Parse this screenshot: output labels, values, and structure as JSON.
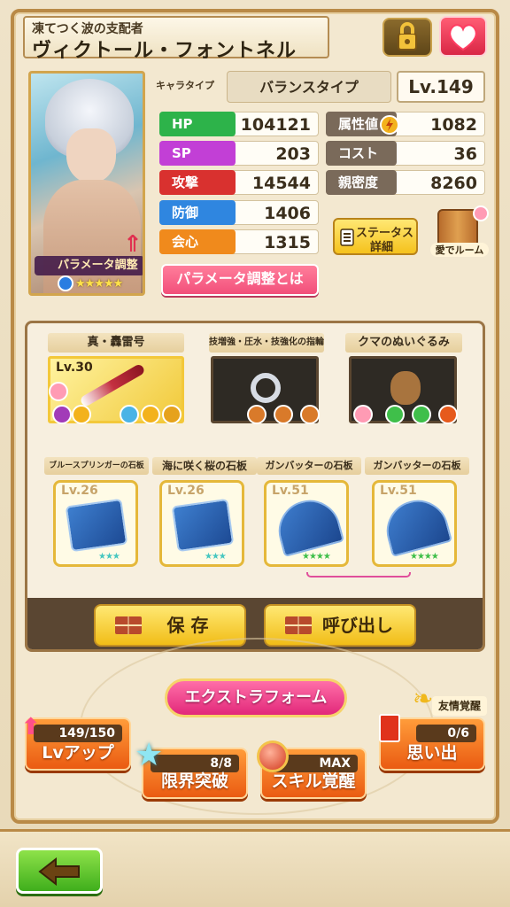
{
  "header": {
    "subtitle": "凍てつく波の支配者",
    "name": "ヴィクトール・フォントネル"
  },
  "portrait": {
    "param_label": "パラメータ調整",
    "stars": "★★★★★",
    "rarity": 5
  },
  "char": {
    "type_label": "キャラタイプ",
    "type_value": "バランスタイプ",
    "level": "Lv.149"
  },
  "stats": [
    {
      "label": "HP",
      "value": "104121",
      "color": "#2db34a"
    },
    {
      "label": "SP",
      "value": "203",
      "color": "#c23fd6"
    },
    {
      "label": "攻撃",
      "value": "14544",
      "color": "#d9312f"
    },
    {
      "label": "防御",
      "value": "1406",
      "color": "#2f86e0"
    },
    {
      "label": "会心",
      "value": "1315",
      "color": "#f08a1c"
    }
  ],
  "stats_right": [
    {
      "label": "属性値",
      "value": "1082",
      "color": "#7a6a5a"
    },
    {
      "label": "コスト",
      "value": "36",
      "color": "#7a6a5a"
    },
    {
      "label": "親密度",
      "value": "8260",
      "color": "#7a6a5a"
    }
  ],
  "buttons": {
    "param_help": "パラメータ調整とは",
    "status_detail_1": "ステータス",
    "status_detail_2": "詳細",
    "room": "愛でルーム",
    "save": "保 存",
    "load": "呼び出し",
    "extra_form": "エクストラフォーム"
  },
  "equipment": [
    {
      "title": "真・轟雷号",
      "level": "Lv.30"
    },
    {
      "title": "技増強・圧水・技強化の指輪",
      "level": ""
    },
    {
      "title": "クマのぬいぐるみ",
      "level": ""
    }
  ],
  "stones": [
    {
      "title": "ブルースプリンガーの石板",
      "level": "Lv.26",
      "stars": "★★★"
    },
    {
      "title": "海に咲く桜の石板",
      "level": "Lv.26",
      "stars": "★★★"
    },
    {
      "title": "ガンバッターの石板",
      "level": "Lv.51",
      "stars": "★★★★"
    },
    {
      "title": "ガンバッターの石板",
      "level": "Lv.51",
      "stars": "★★★★"
    }
  ],
  "actions": {
    "lvup": {
      "progress": "149/150",
      "label": "Lvアップ"
    },
    "limit": {
      "progress": "8/8",
      "label": "限界突破"
    },
    "skill": {
      "progress": "MAX",
      "label": "スキル覚醒"
    },
    "memory": {
      "badge": "友情覚醒",
      "progress": "0/6",
      "label": "思い出"
    }
  },
  "colors": {
    "accent_pink": "#f24f7a",
    "gold": "#f5c21c",
    "orange": "#ea5b12",
    "back_green": "#3fae1c"
  }
}
